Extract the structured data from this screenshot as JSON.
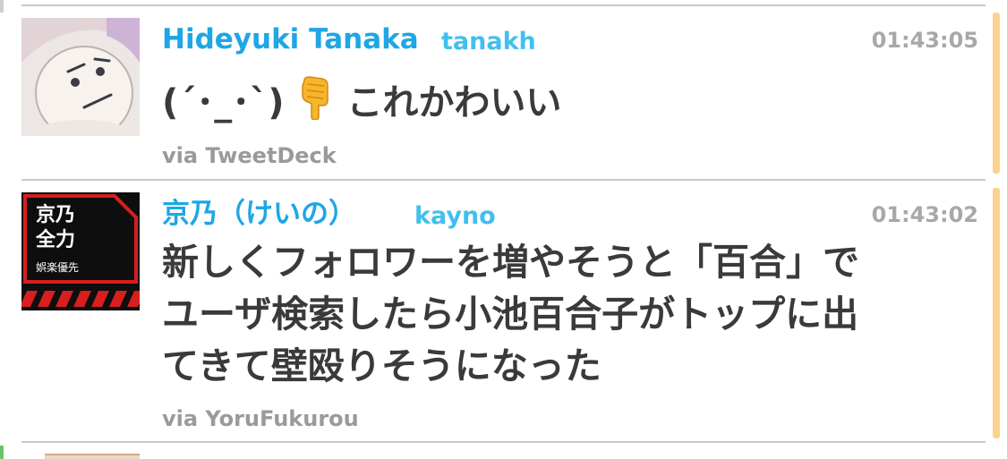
{
  "colors": {
    "display_name": "#1fa6e6",
    "screen_name": "#40c0ef",
    "body": "#3a3a3a",
    "meta": "#a8a8a8",
    "accent_bar": "#fcd38d",
    "divider": "#c9c9c9"
  },
  "tweets": [
    {
      "display_name": "Hideyuki Tanaka",
      "screen_name": "tanakh",
      "time": "01:43:05",
      "body_before_emoji": "(´･_･`)",
      "emoji": "backhand-index-pointing-down",
      "body_after_emoji": "これかわいい",
      "via": "via TweetDeck"
    },
    {
      "display_name": "京乃（けいの）",
      "screen_name": "kayno",
      "time": "01:43:02",
      "body_lines": [
        "新しくフォロワーを増やそうと「百合」で",
        "ユーザ検索したら小池百合子がトップに出",
        "てきて壁殴りそうになった"
      ],
      "via": "via YoruFukurou",
      "avatar_text": [
        "京乃",
        "全力",
        "娯楽優先"
      ]
    }
  ]
}
